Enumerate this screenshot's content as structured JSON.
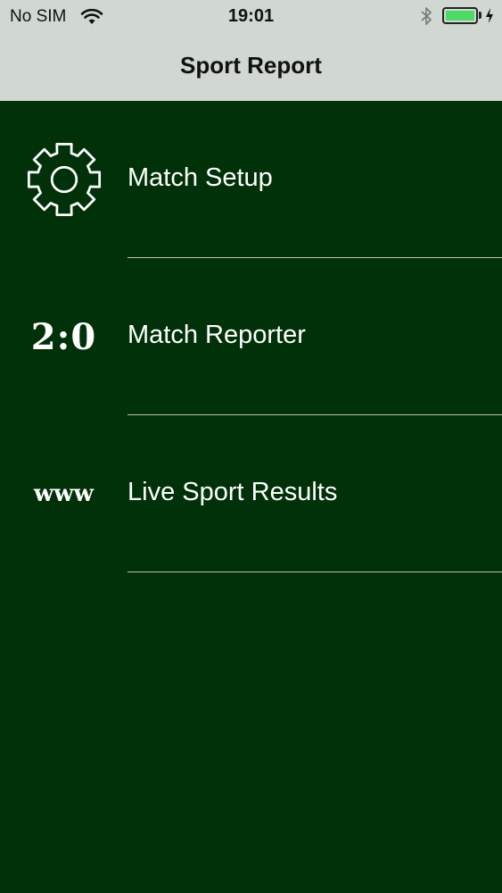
{
  "status_bar": {
    "carrier": "No SIM",
    "time": "19:01",
    "wifi_icon": "wifi-icon",
    "bluetooth_icon": "bluetooth-icon",
    "battery_icon": "battery-icon",
    "battery_level": 1.0,
    "battery_color": "#4cd964",
    "charging_icon": "charging-bolt-icon"
  },
  "nav": {
    "title": "Sport Report",
    "background": "#d1d7d1"
  },
  "theme": {
    "background": "#003108",
    "text": "#ffffff"
  },
  "menu": {
    "items": [
      {
        "label": "Match Setup",
        "icon": "gear-icon",
        "icon_text": ""
      },
      {
        "label": "Match Reporter",
        "icon": "scoreboard-icon",
        "icon_text": "2:0"
      },
      {
        "label": "Live Sport Results",
        "icon": "www-icon",
        "icon_text": "www"
      }
    ]
  }
}
